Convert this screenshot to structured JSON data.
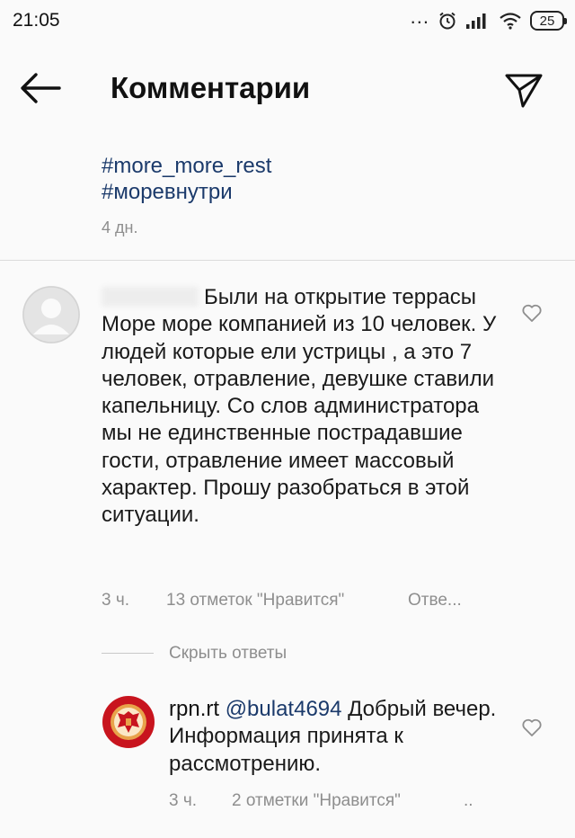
{
  "status_bar": {
    "time": "21:05",
    "dots": "...",
    "battery": "25"
  },
  "header": {
    "title": "Комментарии"
  },
  "caption": {
    "hashtags": [
      "#more_more_rest",
      "#моревнутри"
    ],
    "time": "4 дн."
  },
  "comment": {
    "text": "Были на открытие террасы Море море компанией из 10 человек. У людей которые ели устрицы , а это 7 человек, отравление, девушке ставили капельницу. Со слов администратора мы не единственные пострадавшие гости, отравление имеет массовый характер. Прошу разобраться в этой ситуации.",
    "time": "3 ч.",
    "likes": "13 отметок \"Нравится\"",
    "reply_label": "Отве..."
  },
  "hide_replies": "Скрыть ответы",
  "reply": {
    "username": "rpn.rt",
    "mention": "@bulat4694",
    "text": "Добрый вечер. Информация принята к рассмотрению.",
    "time": "3 ч.",
    "likes": "2 отметки \"Нравится\"",
    "more": ".."
  },
  "colors": {
    "hashtag": "#1b3a6b",
    "meta": "#8e8e8e",
    "logo_red": "#c8141e",
    "logo_orange": "#e8a24a"
  },
  "icons": [
    "back-arrow-icon",
    "direct-send-icon",
    "heart-icon",
    "alarm-icon",
    "signal-icon",
    "wifi-icon",
    "battery-icon"
  ]
}
